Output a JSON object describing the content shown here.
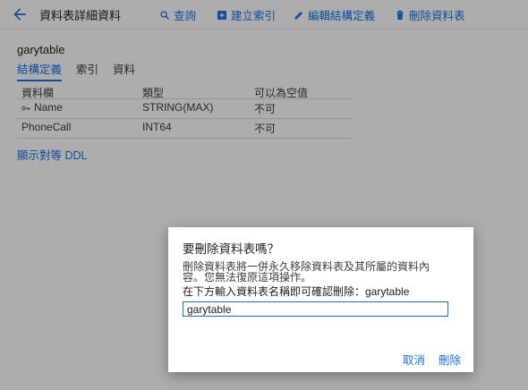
{
  "header": {
    "title": "資料表詳細資料",
    "actions": [
      {
        "label": "查詢",
        "icon": "search-icon"
      },
      {
        "label": "建立索引",
        "icon": "add-box-icon"
      },
      {
        "label": "編輯結構定義",
        "icon": "pencil-icon"
      },
      {
        "label": "刪除資料表",
        "icon": "trash-icon"
      }
    ]
  },
  "table": {
    "name": "garytable",
    "tabs": [
      "結構定義",
      "索引",
      "資料"
    ],
    "active_tab": "結構定義",
    "columns": [
      "資料欄",
      "類型",
      "可以為空值"
    ],
    "rows": [
      {
        "name": "Name",
        "type": "STRING(MAX)",
        "nullable": "不可",
        "is_key": true
      },
      {
        "name": "PhoneCall",
        "type": "INT64",
        "nullable": "不可",
        "is_key": false
      }
    ],
    "ddl_link": "顯示對等 DDL"
  },
  "dialog": {
    "title": "要刪除資料表嗎？",
    "message": "刪除資料表將一併永久移除資料表及其所屬的資料內容。您無法復原這項操作。",
    "confirm_prompt": "在下方輸入資料表名稱即可確認刪除：garytable",
    "input_value": "garytable",
    "cancel_label": "取消",
    "delete_label": "刪除"
  },
  "colors": {
    "accent": "#1a73e8",
    "scrim": "rgba(0,0,0,0.32)"
  }
}
